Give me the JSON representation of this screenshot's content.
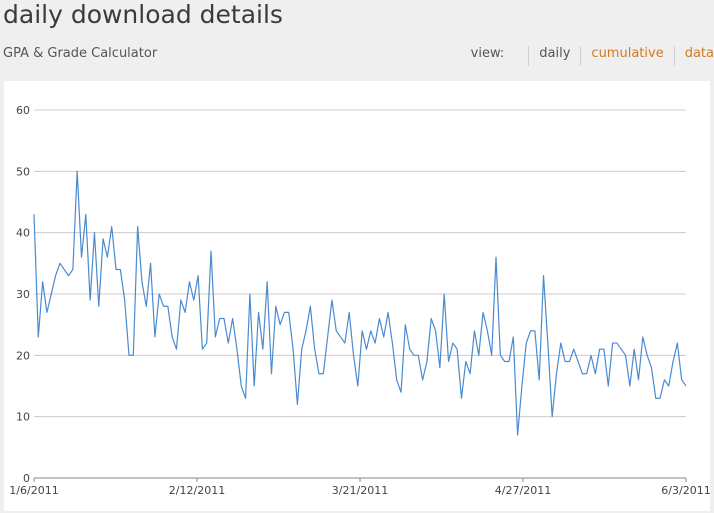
{
  "header": {
    "title": "daily download details",
    "app_name": "GPA & Grade Calculator",
    "view_label": "view:",
    "view_options": [
      "daily",
      "cumulative",
      "data"
    ],
    "selected_view": "daily"
  },
  "colors": {
    "line": "#4a8bd0",
    "grid": "#cccccc",
    "link": "#d27a1f",
    "background": "#efefef"
  },
  "chart_data": {
    "type": "line",
    "title": "",
    "xlabel": "",
    "ylabel": "",
    "ylim": [
      0,
      60
    ],
    "yticks": [
      0,
      10,
      20,
      30,
      40,
      50,
      60
    ],
    "xticks": [
      "1/6/2011",
      "2/12/2011",
      "3/21/2011",
      "4/27/2011",
      "6/3/2011"
    ],
    "grid": true,
    "series": [
      {
        "values": [
          43,
          23,
          32,
          27,
          30,
          33,
          35,
          34,
          33,
          34,
          50,
          36,
          43,
          29,
          40,
          28,
          39,
          36,
          41,
          34,
          34,
          29,
          20,
          20,
          41,
          32,
          28,
          35,
          23,
          30,
          28,
          28,
          23,
          21,
          29,
          27,
          32,
          29,
          33,
          21,
          22,
          37,
          23,
          26,
          26,
          22,
          26,
          21,
          15,
          13,
          30,
          15,
          27,
          21,
          32,
          17,
          28,
          25,
          27,
          27,
          21,
          12,
          21,
          24,
          28,
          21,
          17,
          17,
          23,
          29,
          24,
          23,
          22,
          27,
          20,
          15,
          24,
          21,
          24,
          22,
          26,
          23,
          27,
          22,
          16,
          14,
          25,
          21,
          20,
          20,
          16,
          19,
          26,
          24,
          18,
          30,
          19,
          22,
          21,
          13,
          19,
          17,
          24,
          20,
          27,
          24,
          20,
          36,
          20,
          19,
          19,
          23,
          7,
          15,
          22,
          24,
          24,
          16,
          33,
          22,
          10,
          17,
          22,
          19,
          19,
          21,
          19,
          17,
          17,
          20,
          17,
          21,
          21,
          15,
          22,
          22,
          21,
          20,
          15,
          21,
          16,
          23,
          20,
          18,
          13,
          13,
          16,
          15,
          19,
          22,
          16,
          15
        ]
      }
    ]
  }
}
